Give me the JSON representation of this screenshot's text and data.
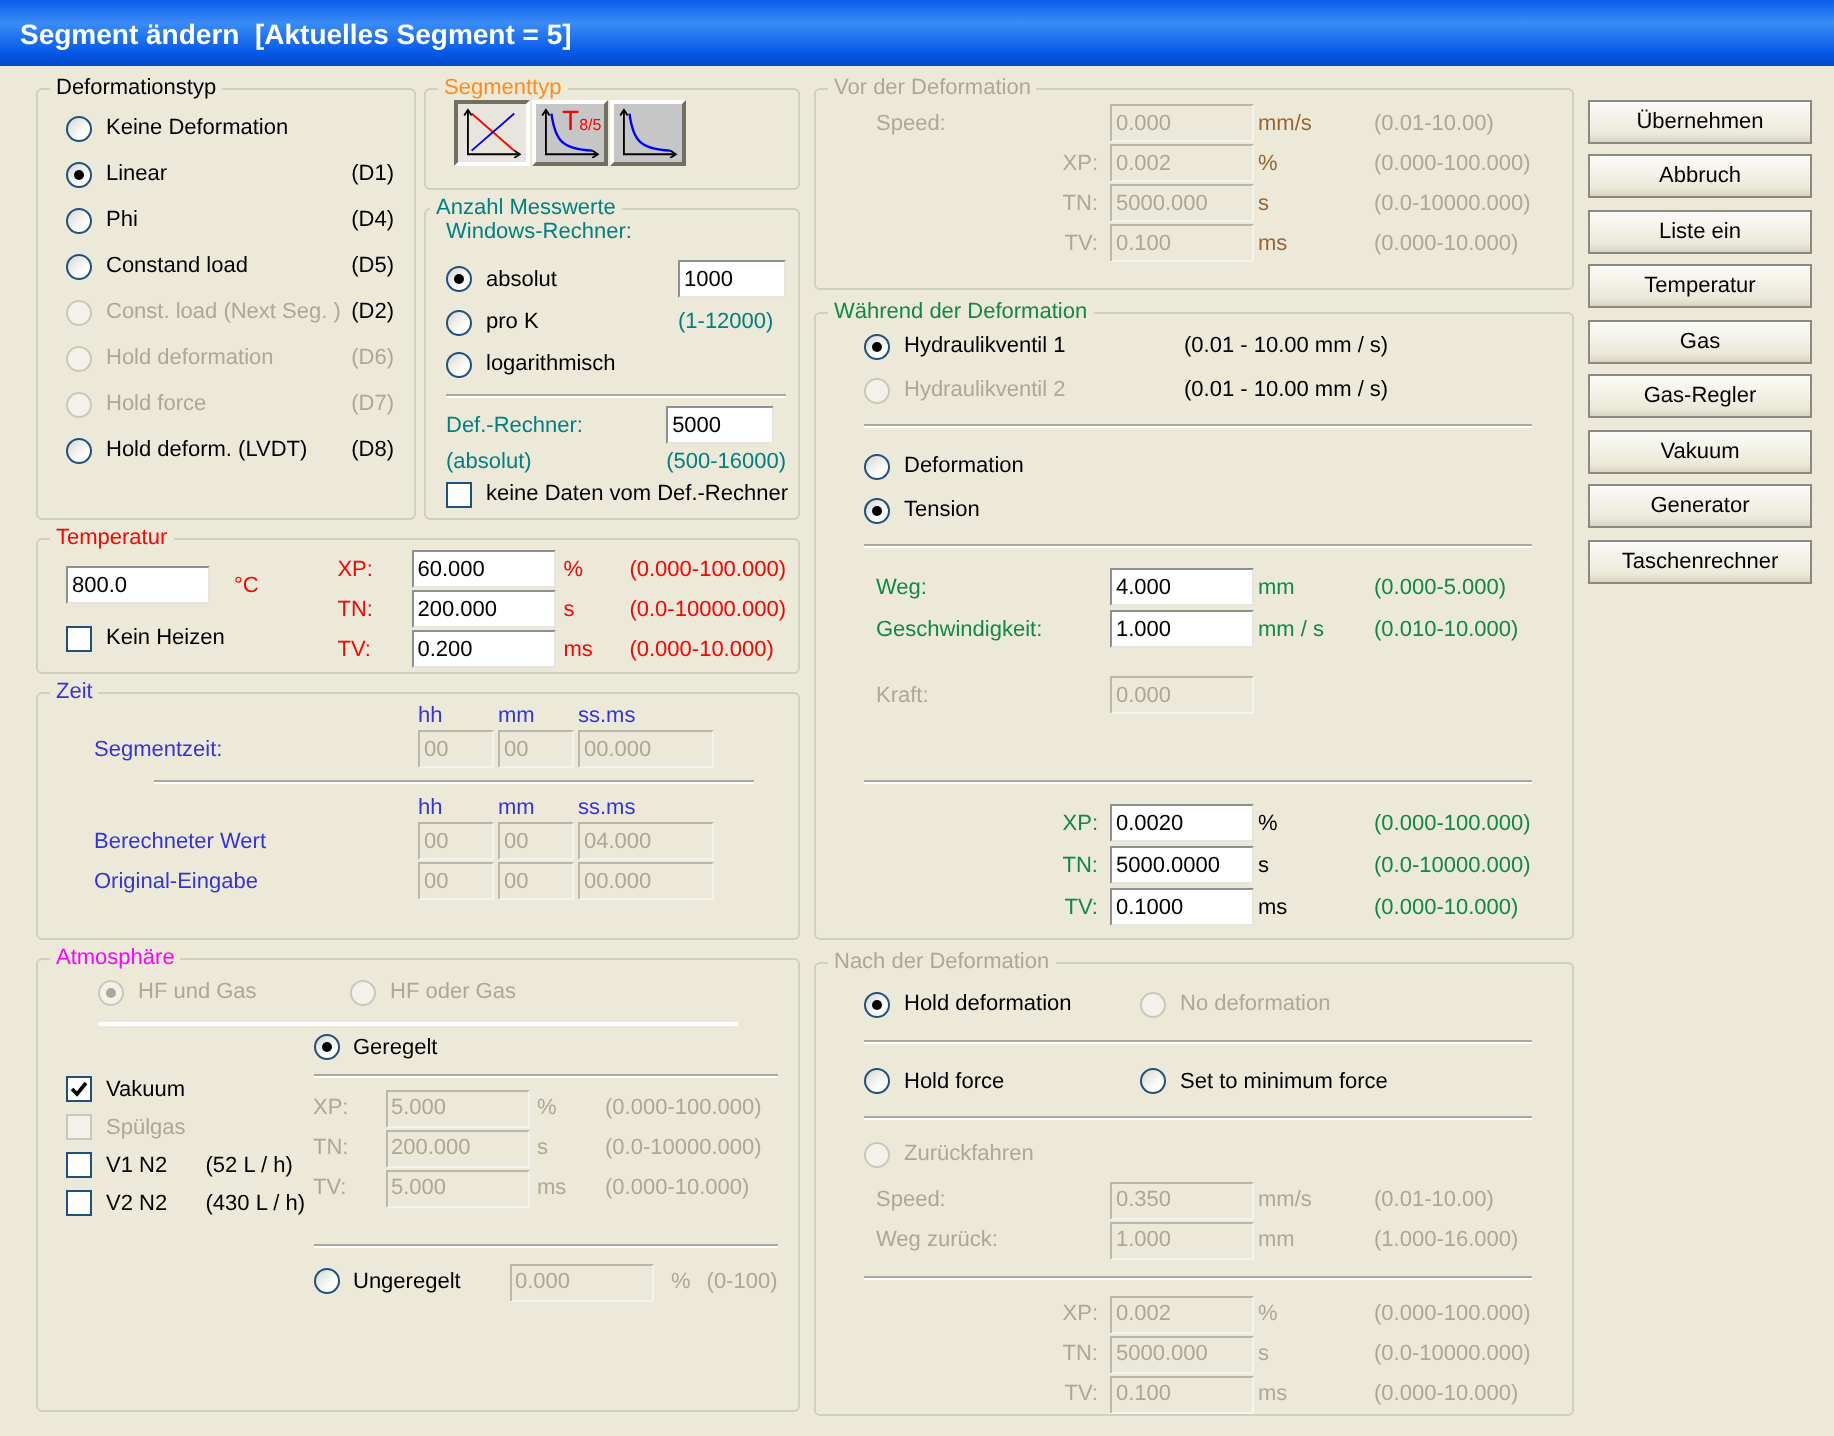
{
  "window": {
    "title": "Segment ändern  [Aktuelles Segment = 5]"
  },
  "deformationstyp": {
    "title": "Deformationstyp",
    "options": [
      {
        "label": "Keine Deformation",
        "selected": false,
        "disabled": false
      },
      {
        "label": "Linear",
        "code": "(D1)",
        "code_disabled": false,
        "selected": true,
        "disabled": false
      },
      {
        "label": "Phi",
        "code": "(D4)",
        "code_disabled": false,
        "selected": false,
        "disabled": false
      },
      {
        "label": "Constand load",
        "code": "(D5)",
        "code_disabled": false,
        "selected": false,
        "disabled": false
      },
      {
        "label": "Const. load  (Next Seg. )",
        "code": "(D2)",
        "code_disabled": false,
        "selected": false,
        "disabled": true
      },
      {
        "label": "Hold deformation",
        "code": "(D6)",
        "code_disabled": true,
        "selected": false,
        "disabled": true
      },
      {
        "label": "Hold force",
        "code": "(D7)",
        "code_disabled": true,
        "selected": false,
        "disabled": true
      },
      {
        "label": "Hold deform. (LVDT)",
        "code": "(D8)",
        "code_disabled": false,
        "selected": false,
        "disabled": false
      }
    ]
  },
  "segmenttyp": {
    "title": "Segmenttyp",
    "buttons": [
      {
        "kind": "cross",
        "selected": true
      },
      {
        "kind": "decay",
        "label": "T$_{8/5}$",
        "selected": false
      },
      {
        "kind": "decay",
        "selected": false
      }
    ]
  },
  "messwerte": {
    "title": "Anzahl Messwerte",
    "subtitle": "Windows-Rechner:",
    "options": [
      {
        "label": "absolut",
        "selected": true,
        "value": "1000"
      },
      {
        "label": "pro K",
        "selected": false,
        "range": "(1-12000)"
      },
      {
        "label": "logarithmisch",
        "selected": false
      }
    ],
    "def_label": "Def.-Rechner:",
    "def_value": "5000",
    "def_note": "(absolut)",
    "def_range": "(500-16000)",
    "checkbox": {
      "label": "keine Daten vom Def.-Rechner",
      "checked": false
    }
  },
  "temperatur": {
    "title": "Temperatur",
    "value": "800.0",
    "unit": "°C",
    "heating": {
      "label": "Kein Heizen",
      "checked": false
    },
    "params": [
      {
        "label": "XP:",
        "value": "60.000",
        "unit": "%",
        "range": "(0.000-100.000)",
        "disabled": false
      },
      {
        "label": "TN:",
        "value": "200.000",
        "unit": "s",
        "range": "(0.0-10000.000)",
        "disabled": false
      },
      {
        "label": "TV:",
        "value": "0.200",
        "unit": "ms",
        "range": "(0.000-10.000)",
        "disabled": false
      }
    ]
  },
  "zeit": {
    "title": "Zeit",
    "blocks": [
      {
        "headers": [
          "hh",
          "mm",
          "ss.ms"
        ],
        "rows": [
          {
            "label": "Segmentzeit:",
            "values": [
              "00",
              "00",
              "00.000"
            ],
            "disabled": true
          }
        ]
      },
      {
        "headers": [
          "hh",
          "mm",
          "ss.ms"
        ],
        "rows": [
          {
            "label": "Berechneter Wert",
            "values": [
              "00",
              "00",
              "04.000"
            ],
            "disabled": true
          },
          {
            "label": "Original-Eingabe",
            "values": [
              "00",
              "00",
              "00.000"
            ],
            "disabled": true
          }
        ]
      }
    ]
  },
  "atmosphaere": {
    "title": "Atmosphäre",
    "modes": [
      {
        "label": "HF und Gas",
        "selected": true,
        "disabled": true
      },
      {
        "label": "HF oder Gas",
        "selected": false,
        "disabled": true
      }
    ],
    "geregelt": {
      "label": "Geregelt",
      "selected": true,
      "disabled": false
    },
    "checks": [
      {
        "label": "Vakuum",
        "checked": true,
        "disabled": false
      },
      {
        "label": "Spülgas",
        "checked": false,
        "disabled": true
      },
      {
        "label": "V1 N2",
        "rate": "(52 L / h)",
        "checked": false,
        "disabled": false
      },
      {
        "label": "V2 N2",
        "rate": "(430 L / h)",
        "checked": false,
        "disabled": false
      }
    ],
    "params": [
      {
        "label": "XP:",
        "value": "5.000",
        "unit": "%",
        "range": "(0.000-100.000)",
        "disabled": true
      },
      {
        "label": "TN:",
        "value": "200.000",
        "unit": "s",
        "range": "(0.0-10000.000)",
        "disabled": true
      },
      {
        "label": "TV:",
        "value": "5.000",
        "unit": "ms",
        "range": "(0.000-10.000)",
        "disabled": true
      }
    ],
    "ungeregelt": {
      "label": "Ungeregelt",
      "selected": false,
      "disabled": false,
      "value": "0.000",
      "unit": "%",
      "range": "(0-100)",
      "field_disabled": true
    }
  },
  "vor": {
    "title": "Vor der Deformation",
    "speed": {
      "label": "Speed:",
      "value": "0.000",
      "unit": "mm/s",
      "range": "(0.01-10.00)",
      "disabled": true
    },
    "pid": [
      {
        "label": "XP:",
        "value": "0.002",
        "unit": "%",
        "range": "(0.000-100.000)",
        "disabled": true
      },
      {
        "label": "TN:",
        "value": "5000.000",
        "unit": "s",
        "range": "(0.0-10000.000)",
        "disabled": true
      },
      {
        "label": "TV:",
        "value": "0.100",
        "unit": "ms",
        "range": "(0.000-10.000)",
        "disabled": true
      }
    ]
  },
  "waehrend": {
    "title": "Während der Deformation",
    "valves": [
      {
        "label": "Hydraulikventil 1",
        "range": "(0.01 - 10.00 mm / s)",
        "selected": true,
        "disabled": false
      },
      {
        "label": "Hydraulikventil 2",
        "range": "(0.01 - 10.00 mm / s)",
        "selected": false,
        "disabled": true
      }
    ],
    "modes": [
      {
        "label": "Deformation",
        "selected": false
      },
      {
        "label": "Tension",
        "selected": true
      }
    ],
    "params": [
      {
        "label": "Weg:",
        "value": "4.000",
        "unit": "mm",
        "range": "(0.000-5.000)",
        "disabled": false
      },
      {
        "label": "Geschwindigkeit:",
        "value": "1.000",
        "unit": "mm / s",
        "range": "(0.010-10.000)",
        "disabled": false
      }
    ],
    "kraft": {
      "label": "Kraft:",
      "value": "0.000",
      "disabled": true
    },
    "pid": [
      {
        "label": "XP:",
        "value": "0.0020",
        "unit": "%",
        "range": "(0.000-100.000)",
        "disabled": false
      },
      {
        "label": "TN:",
        "value": "5000.0000",
        "unit": "s",
        "range": "(0.0-10000.000)",
        "disabled": false
      },
      {
        "label": "TV:",
        "value": "0.1000",
        "unit": "ms",
        "range": "(0.000-10.000)",
        "disabled": false
      }
    ]
  },
  "nach": {
    "title": "Nach der Deformation",
    "rows": [
      {
        "options": [
          {
            "label": "Hold deformation",
            "selected": true,
            "disabled": false
          },
          {
            "label": "No deformation",
            "selected": false,
            "disabled": true
          }
        ]
      },
      {
        "options": [
          {
            "label": "Hold force",
            "selected": false,
            "disabled": false
          },
          {
            "label": "Set to minimum force",
            "selected": false,
            "disabled": false
          }
        ]
      }
    ],
    "zurueck": {
      "label": "Zurückfahren",
      "selected": false,
      "disabled": true
    },
    "params": [
      {
        "label": "Speed:",
        "value": "0.350",
        "unit": "mm/s",
        "range": "(0.01-10.00)",
        "disabled": true
      },
      {
        "label": "Weg zurück:",
        "value": "1.000",
        "unit": "mm",
        "range": "(1.000-16.000)",
        "disabled": true
      }
    ],
    "pid": [
      {
        "label": "XP:",
        "value": "0.002",
        "unit": "%",
        "range": "(0.000-100.000)",
        "disabled": true
      },
      {
        "label": "TN:",
        "value": "5000.000",
        "unit": "s",
        "range": "(0.0-10000.000)",
        "disabled": true
      },
      {
        "label": "TV:",
        "value": "0.100",
        "unit": "ms",
        "range": "(0.000-10.000)",
        "disabled": true
      }
    ]
  },
  "buttons": [
    "Übernehmen",
    "Abbruch",
    "Liste ein",
    "Temperatur",
    "Gas",
    "Gas-Regler",
    "Vakuum",
    "Generator",
    "Taschenrechner"
  ]
}
